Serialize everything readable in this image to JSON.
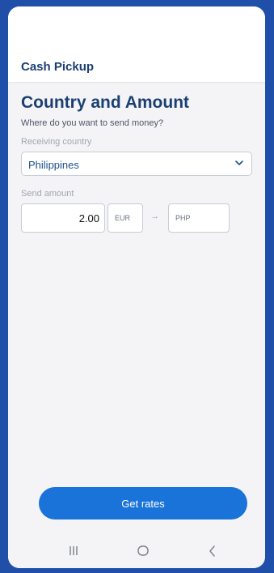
{
  "app": {
    "title": "Cash Pickup"
  },
  "form": {
    "heading": "Country and Amount",
    "question": "Where do you want to send money?",
    "country_label": "Receiving country",
    "country_value": "Philippines",
    "amount_label": "Send amount",
    "amount_value": "2.00",
    "from_currency": "EUR",
    "arrow": "→",
    "to_currency": "PHP"
  },
  "actions": {
    "get_rates_label": "Get rates"
  },
  "colors": {
    "background": "#1f4fa8",
    "primary": "#1a73d9",
    "heading": "#1b3f73"
  },
  "nav": {
    "recents_icon": "recents-icon",
    "home_icon": "home-icon",
    "back_icon": "back-icon"
  }
}
